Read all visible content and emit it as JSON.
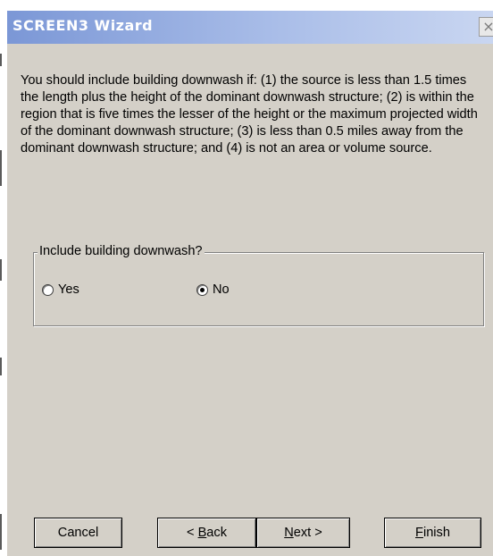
{
  "window": {
    "title": "SCREEN3 Wizard",
    "close_glyph": "×"
  },
  "description": "You should include building downwash if: (1) the source is less than 1.5 times the length plus the height of the dominant downwash structure; (2) is within the region that is five times the lesser of the height or the maximum projected width of the dominant downwash structure; (3) is less than 0.5 miles away from the dominant downwash structure; and (4) is not an area or volume source.",
  "downwash_group": {
    "label": "Include building downwash?",
    "options": [
      {
        "label": "Yes",
        "checked": false
      },
      {
        "label": "No",
        "checked": true
      }
    ]
  },
  "buttons": {
    "cancel": "Cancel",
    "back_prefix": "< ",
    "back_mnemonic": "B",
    "back_rest": "ack",
    "next_mnemonic": "N",
    "next_rest": "ext >",
    "finish_mnemonic": "F",
    "finish_rest": "inish"
  },
  "colors": {
    "face": "#d4d0c8",
    "title_gradient_start": "#7b97d6",
    "title_gradient_end": "#c9d6f1"
  }
}
